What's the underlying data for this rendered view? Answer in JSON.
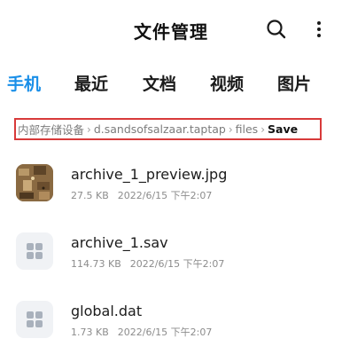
{
  "header": {
    "title": "文件管理",
    "search_icon": "search-icon",
    "more_icon": "more-vertical-icon"
  },
  "tabs": [
    {
      "label": "手机",
      "active": true
    },
    {
      "label": "最近",
      "active": false
    },
    {
      "label": "文档",
      "active": false
    },
    {
      "label": "视频",
      "active": false
    },
    {
      "label": "图片",
      "active": false
    }
  ],
  "breadcrumb": {
    "items": [
      "内部存储设备",
      "d.sandsofsalzaar.taptap",
      "files",
      "Save"
    ],
    "separator": "›",
    "highlight_color": "#d83a3a"
  },
  "files": [
    {
      "name": "archive_1_preview.jpg",
      "size": "27.5 KB",
      "date": "2022/6/15 下午2:07",
      "icon": "image-thumbnail"
    },
    {
      "name": "archive_1.sav",
      "size": "114.73 KB",
      "date": "2022/6/15 下午2:07",
      "icon": "generic-file-icon"
    },
    {
      "name": "global.dat",
      "size": "1.73 KB",
      "date": "2022/6/15 下午2:07",
      "icon": "generic-file-icon"
    }
  ],
  "colors": {
    "accent": "#1a8fe8",
    "text": "#1a1a1a",
    "meta": "#8c8c8c",
    "icon_bg": "#f0f2f5"
  }
}
